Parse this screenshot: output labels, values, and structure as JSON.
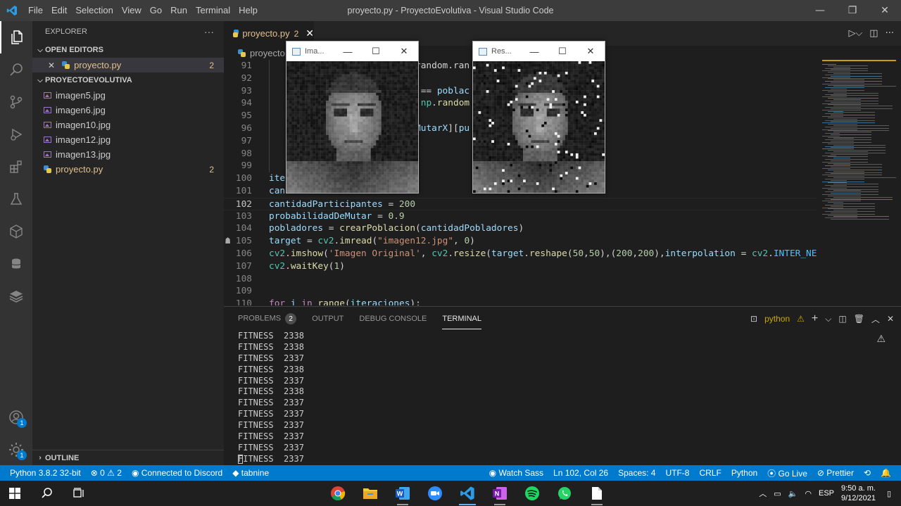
{
  "window": {
    "title": "proyecto.py - ProyectoEvolutiva - Visual Studio Code",
    "menu": [
      "File",
      "Edit",
      "Selection",
      "View",
      "Go",
      "Run",
      "Terminal",
      "Help"
    ],
    "controls": {
      "minimize": "—",
      "restore": "❐",
      "close": "✕"
    }
  },
  "activity_bar": {
    "accounts_badge": "1",
    "manage_badge": "1"
  },
  "sidebar": {
    "header": "EXPLORER",
    "more": "···",
    "open_editors_title": "OPEN EDITORS",
    "open_editors": [
      {
        "close": "✕",
        "name": "proyecto.py",
        "count": "2"
      }
    ],
    "project_title": "PROYECTOEVOLUTIVA",
    "files": [
      {
        "name": "imagen5.jpg",
        "type": "image",
        "count": ""
      },
      {
        "name": "imagen6.jpg",
        "type": "image",
        "count": ""
      },
      {
        "name": "imagen10.jpg",
        "type": "image",
        "count": ""
      },
      {
        "name": "imagen12.jpg",
        "type": "image",
        "count": ""
      },
      {
        "name": "imagen13.jpg",
        "type": "image",
        "count": ""
      },
      {
        "name": "proyecto.py",
        "type": "python",
        "count": "2"
      }
    ],
    "outline_title": "OUTLINE"
  },
  "editor": {
    "tab": {
      "name": "proyecto.py",
      "count": "2",
      "close": "✕"
    },
    "breadcrumb": "proyecto.",
    "current_line": "102",
    "lines": [
      {
        "n": "91",
        "tokens": [
          [
            "t-op",
            "                          .random.ran"
          ]
        ]
      },
      {
        "n": "92",
        "tokens": [
          [
            "t-op",
            ""
          ]
        ]
      },
      {
        "n": "93",
        "tokens": [
          [
            "t-op",
            "                          r == "
          ],
          [
            "t-var",
            "poblac"
          ],
          [
            "t-op",
            "                "
          ],
          [
            "t-var",
            "utarY"
          ],
          [
            "t-op",
            "]:"
          ]
        ]
      },
      {
        "n": "94",
        "tokens": [
          [
            "t-op",
            "                          = "
          ],
          [
            "t-mod",
            "np"
          ],
          [
            "t-op",
            "."
          ],
          [
            "t-fn",
            "random"
          ]
        ]
      },
      {
        "n": "95",
        "tokens": [
          [
            "t-op",
            ""
          ]
        ]
      },
      {
        "n": "96",
        "tokens": [
          [
            "t-op",
            "                          "
          ],
          [
            "t-var",
            "oMutarX"
          ],
          [
            "t-op",
            "]["
          ],
          [
            "t-var",
            "pu"
          ]
        ]
      },
      {
        "n": "97",
        "tokens": [
          [
            "t-op",
            ""
          ]
        ]
      },
      {
        "n": "98",
        "tokens": [
          [
            "t-op",
            ""
          ]
        ]
      },
      {
        "n": "99",
        "tokens": [
          [
            "t-op",
            ""
          ]
        ]
      },
      {
        "n": "100",
        "tokens": [
          [
            "t-var",
            "iter"
          ]
        ]
      },
      {
        "n": "101",
        "tokens": [
          [
            "t-var",
            "cantidadPobladores"
          ],
          [
            "t-op",
            " = "
          ],
          [
            "t-num",
            "200"
          ]
        ]
      },
      {
        "n": "102",
        "tokens": [
          [
            "t-var",
            "cantidadParticipantes"
          ],
          [
            "t-op",
            " = "
          ],
          [
            "t-num",
            "200"
          ]
        ]
      },
      {
        "n": "103",
        "tokens": [
          [
            "t-var",
            "probabilidadDeMutar"
          ],
          [
            "t-op",
            " = "
          ],
          [
            "t-num",
            "0.9"
          ]
        ]
      },
      {
        "n": "104",
        "tokens": [
          [
            "t-var",
            "pobladores"
          ],
          [
            "t-op",
            " = "
          ],
          [
            "t-fn",
            "crearPoblacion"
          ],
          [
            "t-op",
            "("
          ],
          [
            "t-var",
            "cantidadPobladores"
          ],
          [
            "t-op",
            ")"
          ]
        ]
      },
      {
        "n": "105",
        "tokens": [
          [
            "t-var",
            "target"
          ],
          [
            "t-op",
            " = "
          ],
          [
            "t-mod",
            "cv2"
          ],
          [
            "t-op",
            "."
          ],
          [
            "t-fn",
            "imread"
          ],
          [
            "t-op",
            "("
          ],
          [
            "t-str",
            "\"imagen12.jpg\""
          ],
          [
            "t-op",
            ", "
          ],
          [
            "t-num",
            "0"
          ],
          [
            "t-op",
            ")"
          ]
        ]
      },
      {
        "n": "106",
        "tokens": [
          [
            "t-mod",
            "cv2"
          ],
          [
            "t-op",
            "."
          ],
          [
            "t-fn",
            "imshow"
          ],
          [
            "t-op",
            "("
          ],
          [
            "t-str",
            "'Imagen Original'"
          ],
          [
            "t-op",
            ", "
          ],
          [
            "t-mod",
            "cv2"
          ],
          [
            "t-op",
            "."
          ],
          [
            "t-fn",
            "resize"
          ],
          [
            "t-op",
            "("
          ],
          [
            "t-var",
            "target"
          ],
          [
            "t-op",
            "."
          ],
          [
            "t-fn",
            "reshape"
          ],
          [
            "t-op",
            "("
          ],
          [
            "t-num",
            "50"
          ],
          [
            "t-op",
            ","
          ],
          [
            "t-num",
            "50"
          ],
          [
            "t-op",
            "),("
          ],
          [
            "t-num",
            "200"
          ],
          [
            "t-op",
            ","
          ],
          [
            "t-num",
            "200"
          ],
          [
            "t-op",
            "),"
          ],
          [
            "t-var",
            "interpolation"
          ],
          [
            "t-op",
            " = "
          ],
          [
            "t-mod",
            "cv2"
          ],
          [
            "t-op",
            "."
          ],
          [
            "t-const",
            "INTER_NEAREST"
          ],
          [
            "t-op",
            "))"
          ]
        ]
      },
      {
        "n": "107",
        "tokens": [
          [
            "t-mod",
            "cv2"
          ],
          [
            "t-op",
            "."
          ],
          [
            "t-fn",
            "waitKey"
          ],
          [
            "t-op",
            "("
          ],
          [
            "t-num",
            "1"
          ],
          [
            "t-op",
            ")"
          ]
        ]
      },
      {
        "n": "108",
        "tokens": [
          [
            "t-op",
            ""
          ]
        ]
      },
      {
        "n": "109",
        "tokens": [
          [
            "t-op",
            ""
          ]
        ]
      },
      {
        "n": "110",
        "tokens": [
          [
            "t-kw",
            "for"
          ],
          [
            "t-op",
            " "
          ],
          [
            "t-var",
            "i"
          ],
          [
            "t-op",
            " "
          ],
          [
            "t-kw",
            "in"
          ],
          [
            "t-op",
            " "
          ],
          [
            "t-fn",
            "range"
          ],
          [
            "t-op",
            "("
          ],
          [
            "t-var",
            "iteraciones"
          ],
          [
            "t-op",
            "):"
          ]
        ]
      }
    ]
  },
  "panel": {
    "tabs": [
      {
        "label": "PROBLEMS",
        "badge": "2"
      },
      {
        "label": "OUTPUT"
      },
      {
        "label": "DEBUG CONSOLE"
      },
      {
        "label": "TERMINAL",
        "active": true
      }
    ],
    "terminal_shell": "python",
    "terminal_lines": [
      "FITNESS  2338",
      "FITNESS  2338",
      "FITNESS  2337",
      "FITNESS  2338",
      "FITNESS  2337",
      "FITNESS  2338",
      "FITNESS  2337",
      "FITNESS  2337",
      "FITNESS  2337",
      "FITNESS  2337",
      "FITNESS  2337",
      "FITNESS  2337"
    ]
  },
  "cv_windows": [
    {
      "title": "Ima..."
    },
    {
      "title": "Res..."
    }
  ],
  "status_bar": {
    "python": "Python 3.8.2 32-bit",
    "errors": "0",
    "warnings": "2",
    "discord": "Connected to Discord",
    "tabnine": "tabnine",
    "watch_sass": "Watch Sass",
    "position": "Ln 102, Col 26",
    "spaces": "Spaces: 4",
    "encoding": "UTF-8",
    "eol": "CRLF",
    "language": "Python",
    "go_live": "Go Live",
    "prettier": "Prettier"
  },
  "taskbar": {
    "language": "ESP",
    "time": "9:50 a. m.",
    "date": "9/12/2021"
  },
  "colors": {
    "accent": "#007acc",
    "titlebar": "#3c3c3c",
    "warning": "#e2c08d"
  }
}
